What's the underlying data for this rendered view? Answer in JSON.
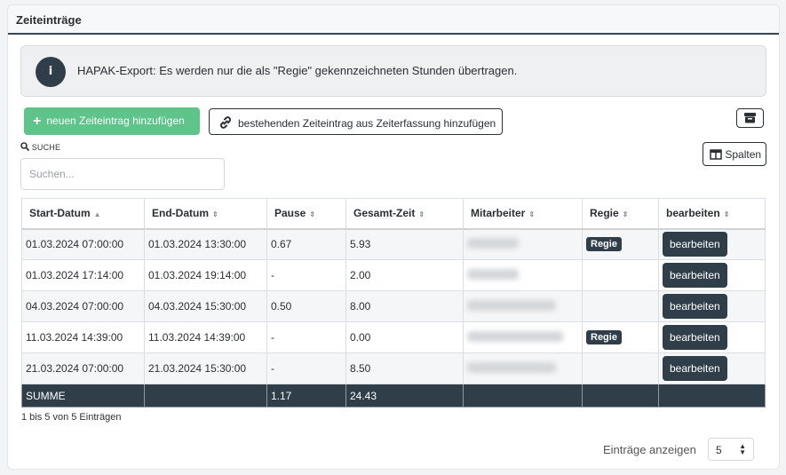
{
  "card": {
    "title": "Zeiteinträge"
  },
  "alert": {
    "icon": "info-icon",
    "text": "HAPAK-Export: Es werden nur die als \"Regie\" gekennzeichneten Stunden übertragen."
  },
  "toolbar": {
    "add_new_label": "neuen Zeiteintrag hinzufügen",
    "add_existing_label": "bestehenden Zeiteintrag aus Zeiterfassung hinzufügen",
    "columns_label": "Spalten"
  },
  "search": {
    "label": "SUCHE",
    "placeholder": "Suchen..."
  },
  "table": {
    "headers": [
      "Start-Datum",
      "End-Datum",
      "Pause",
      "Gesamt-Zeit",
      "Mitarbeiter",
      "Regie",
      "bearbeiten"
    ],
    "rows": [
      {
        "start": "01.03.2024 07:00:00",
        "end": "01.03.2024 13:30:00",
        "pause": "0.67",
        "total": "5.93",
        "regie": "Regie",
        "edit": "bearbeiten"
      },
      {
        "start": "01.03.2024 17:14:00",
        "end": "01.03.2024 19:14:00",
        "pause": "-",
        "total": "2.00",
        "regie": "",
        "edit": "bearbeiten"
      },
      {
        "start": "04.03.2024 07:00:00",
        "end": "04.03.2024 15:30:00",
        "pause": "0.50",
        "total": "8.00",
        "regie": "",
        "edit": "bearbeiten"
      },
      {
        "start": "11.03.2024 14:39:00",
        "end": "11.03.2024 14:39:00",
        "pause": "-",
        "total": "0.00",
        "regie": "Regie",
        "edit": "bearbeiten"
      },
      {
        "start": "21.03.2024 07:00:00",
        "end": "21.03.2024 15:30:00",
        "pause": "-",
        "total": "8.50",
        "regie": "",
        "edit": "bearbeiten"
      }
    ],
    "footer": {
      "label": "SUMME",
      "pause": "1.17",
      "total": "24.43"
    }
  },
  "info_text": "1 bis 5 von 5 Einträgen",
  "page_size": {
    "label": "Einträge anzeigen",
    "value": "5"
  }
}
